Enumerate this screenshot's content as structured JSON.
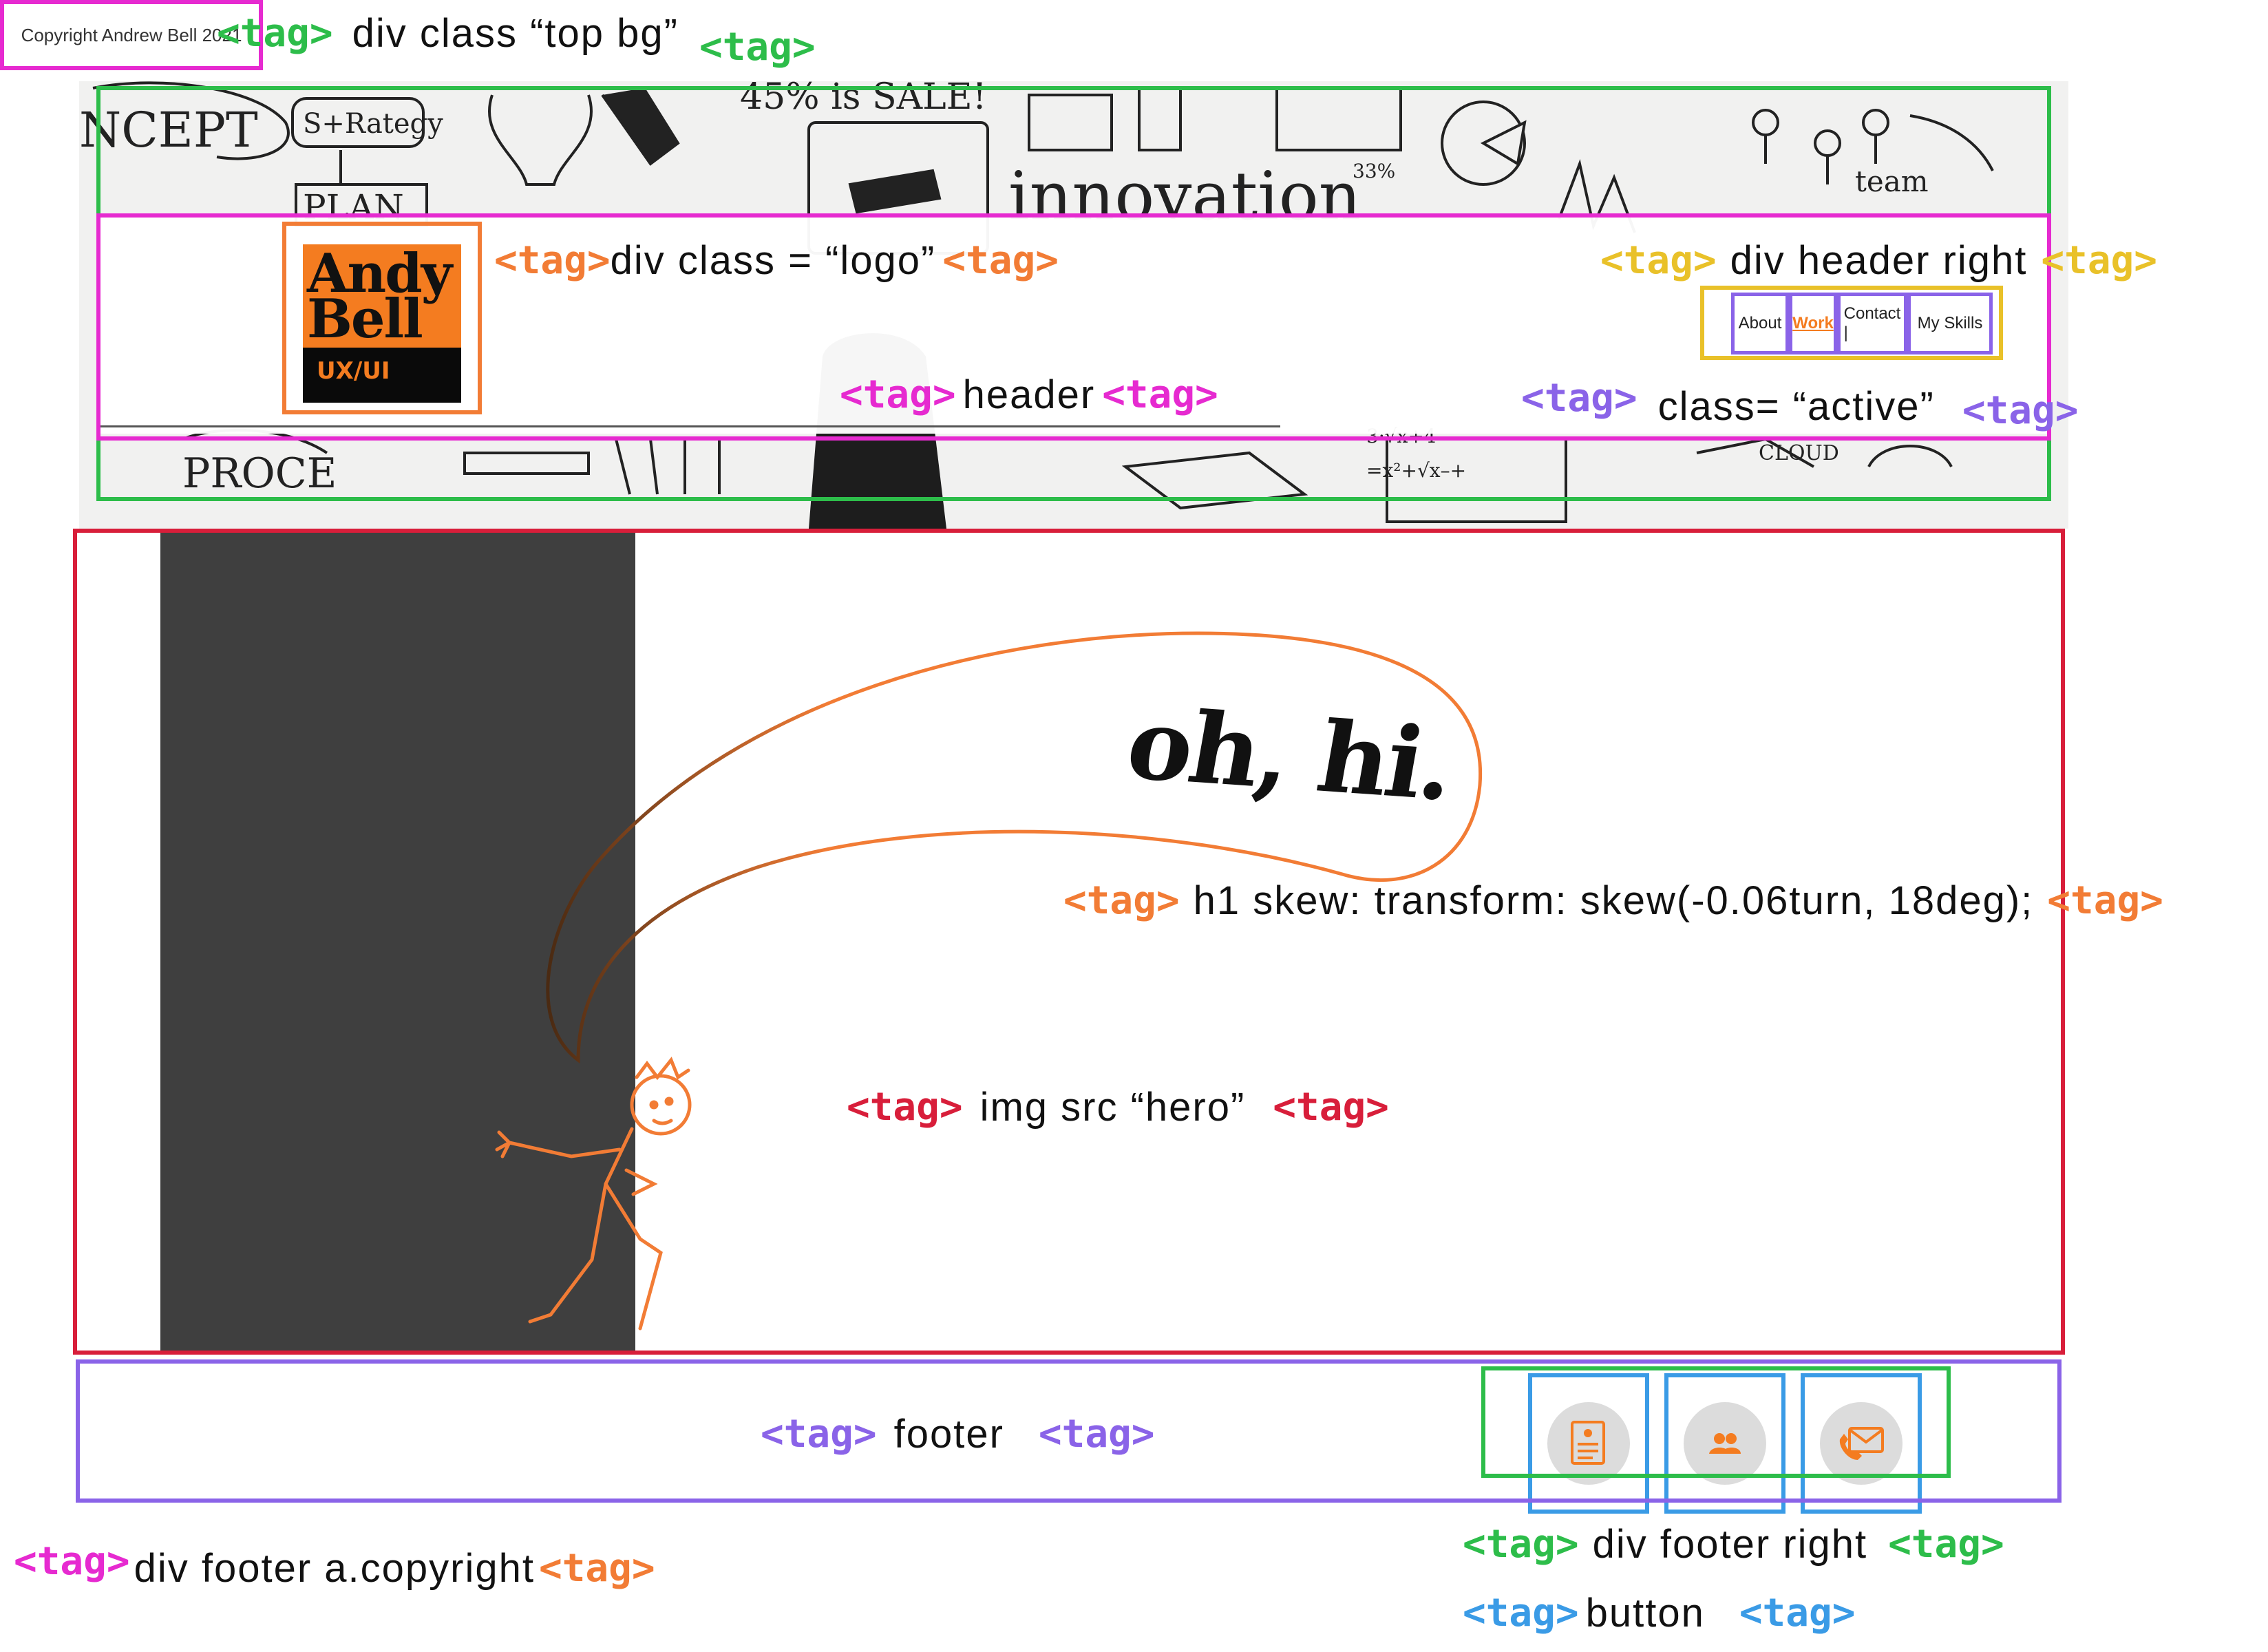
{
  "labels": {
    "top_bg": "div class “top bg”",
    "logo": "div class = “logo”",
    "header_right": "div header right",
    "header": "header",
    "active": "class= “active”",
    "h1": "h1 skew: transform: skew(-0.06turn, 18deg);",
    "hero": "img src “hero”",
    "footer": "footer",
    "footer_copyright": "div footer a.copyright",
    "footer_right": "div footer right",
    "button": "button"
  },
  "tag_text": "<tag>",
  "logo": {
    "line1": "Andy",
    "line2": "Bell",
    "sub": "UX/UI"
  },
  "nav": [
    {
      "label": "About",
      "active": false
    },
    {
      "label": "Work",
      "active": true
    },
    {
      "label": "Contact |",
      "active": false
    },
    {
      "label": "My Skills",
      "active": false
    }
  ],
  "hero": {
    "heading": "oh, hi."
  },
  "footer": {
    "copyright": "Copyright Andrew Bell 2021",
    "buttons": [
      {
        "icon": "resume-document-icon"
      },
      {
        "icon": "people-icon"
      },
      {
        "icon": "phone-email-icon"
      }
    ]
  },
  "doodles": {
    "concept": "NCEPT",
    "strategy": "S+Rategy",
    "plan": "PLAN",
    "sale": "45% is SALE!",
    "innovation": "innovation",
    "team": "team",
    "cloud": "CLOUD",
    "process": "PROCE",
    "pct": "33%",
    "math1": "3·√x+4",
    "math2": "=x²+√x–+"
  },
  "colors": {
    "green": "#2dbd4a",
    "orange": "#f27c35",
    "magenta": "#e62ad0",
    "yellow": "#e9c129",
    "purple": "#8a63e8",
    "red": "#d81e3a",
    "blue": "#3a9be6",
    "logo_orange": "#f47c20",
    "hero_dark": "#3f3f3f"
  }
}
